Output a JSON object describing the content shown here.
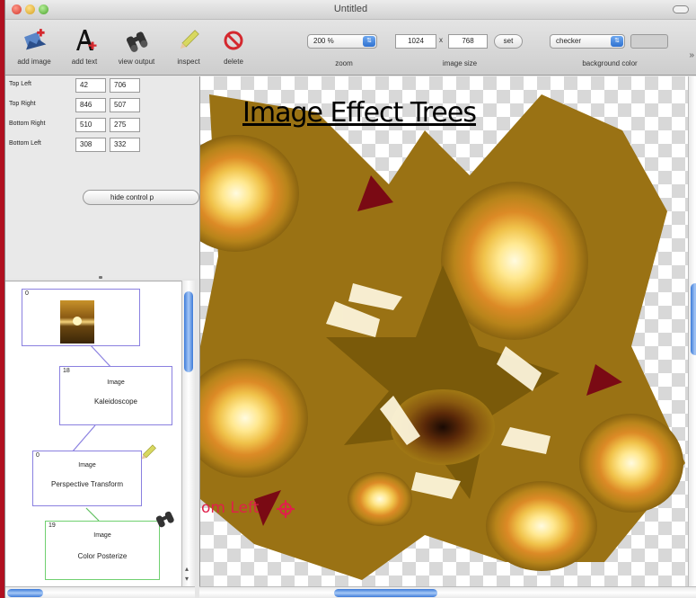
{
  "window": {
    "title": "Untitled"
  },
  "toolbar": {
    "tools": [
      {
        "label": "add image",
        "icon": "add-image-icon"
      },
      {
        "label": "add text",
        "icon": "add-text-icon"
      },
      {
        "label": "view output",
        "icon": "binoculars-icon"
      },
      {
        "label": "inspect",
        "icon": "pencil-icon"
      },
      {
        "label": "delete",
        "icon": "delete-icon"
      }
    ],
    "zoom": {
      "label": "zoom",
      "value": "200 %"
    },
    "image_size": {
      "label": "image size",
      "width": "1024",
      "separator": "x",
      "height": "768",
      "set_label": "set"
    },
    "background": {
      "label": "background color",
      "value": "checker"
    }
  },
  "inspector": {
    "corners": [
      {
        "label": "Top Left",
        "x": "42",
        "y": "706"
      },
      {
        "label": "Top Right",
        "x": "846",
        "y": "507"
      },
      {
        "label": "Bottom Right",
        "x": "510",
        "y": "275"
      },
      {
        "label": "Bottom Left",
        "x": "308",
        "y": "332"
      }
    ],
    "hide_button": "hide control p"
  },
  "tree": {
    "nodes": [
      {
        "index": "0",
        "kind": "",
        "name": ""
      },
      {
        "index": "18",
        "kind": "Image",
        "name": "Kaleidoscope"
      },
      {
        "index": "0",
        "kind": "Image",
        "name": "Perspective Transform"
      },
      {
        "index": "19",
        "kind": "Image",
        "name": "Color Posterize"
      }
    ]
  },
  "canvas": {
    "overlay_title": "Image Effect Trees",
    "handle_label": "om Left"
  },
  "colors": {
    "accent": "#3c7ad8",
    "handle": "#e0204a",
    "node_border": "#8a80e0",
    "desktop": "#b01020"
  }
}
